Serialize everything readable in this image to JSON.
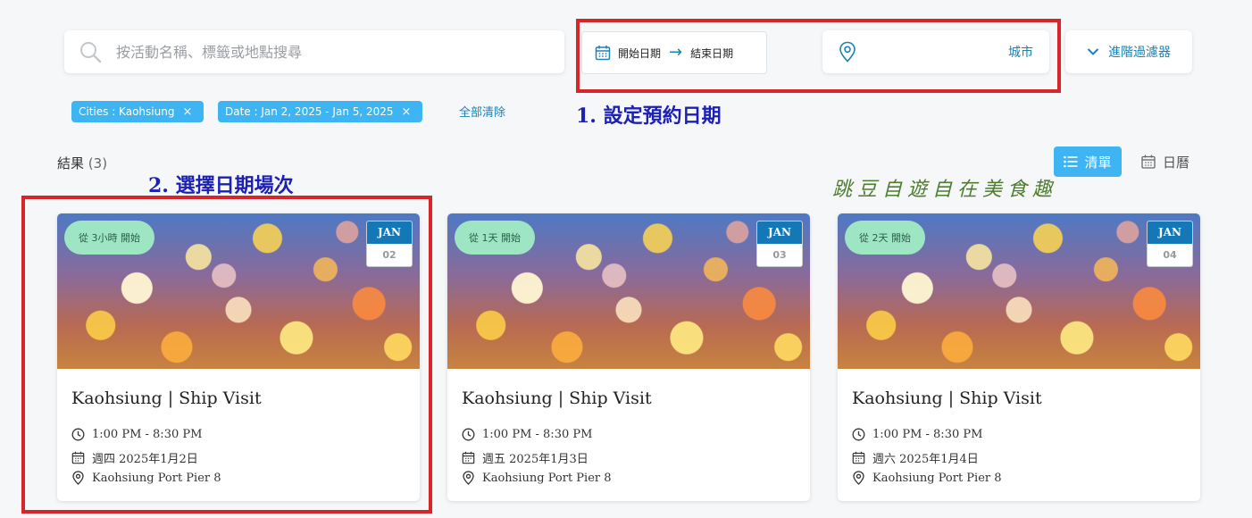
{
  "search": {
    "placeholder": "按活動名稱、標籤或地點搜尋"
  },
  "date_filter": {
    "start_label": "開始日期",
    "end_label": "結束日期"
  },
  "city_filter": {
    "label": "城市"
  },
  "advanced_filter": {
    "label": "進階過濾器"
  },
  "active_filters": [
    {
      "key": "Cities",
      "value": "Kaohsiung"
    },
    {
      "key": "Date",
      "value": "Jan 2, 2025 - Jan 5, 2025"
    }
  ],
  "chips": {
    "cities": "Cities : Kaohsiung",
    "date": "Date : Jan 2, 2025 - Jan 5, 2025",
    "close": "×"
  },
  "clear_all_label": "全部清除",
  "annotations": {
    "step1": "1. 設定預約日期",
    "step2": "2. 選擇日期場次",
    "watermark": "跳豆自遊自在美食趣",
    "box_color": "#d7262b",
    "text_color": "#1c21b4"
  },
  "results": {
    "label": "結果",
    "count": "(3)"
  },
  "view_toggle": {
    "list_label": "清單",
    "calendar_label": "日曆",
    "active": "list"
  },
  "colors": {
    "accent": "#1a82b4",
    "chip": "#3fb4f2",
    "badge": "#9ee6c3",
    "calendar_header": "#1478b7"
  },
  "events": [
    {
      "badge": "從 3小時 開始",
      "month": "JAN",
      "day": "02",
      "title": "Kaohsiung | Ship Visit",
      "time": "1:00 PM - 8:30 PM",
      "date": "週四 2025年1月2日",
      "location": "Kaohsiung Port Pier 8"
    },
    {
      "badge": "從 1天 開始",
      "month": "JAN",
      "day": "03",
      "title": "Kaohsiung | Ship Visit",
      "time": "1:00 PM - 8:30 PM",
      "date": "週五 2025年1月3日",
      "location": "Kaohsiung Port Pier 8"
    },
    {
      "badge": "從 2天 開始",
      "month": "JAN",
      "day": "04",
      "title": "Kaohsiung | Ship Visit",
      "time": "1:00 PM - 8:30 PM",
      "date": "週六 2025年1月4日",
      "location": "Kaohsiung Port Pier 8"
    }
  ]
}
